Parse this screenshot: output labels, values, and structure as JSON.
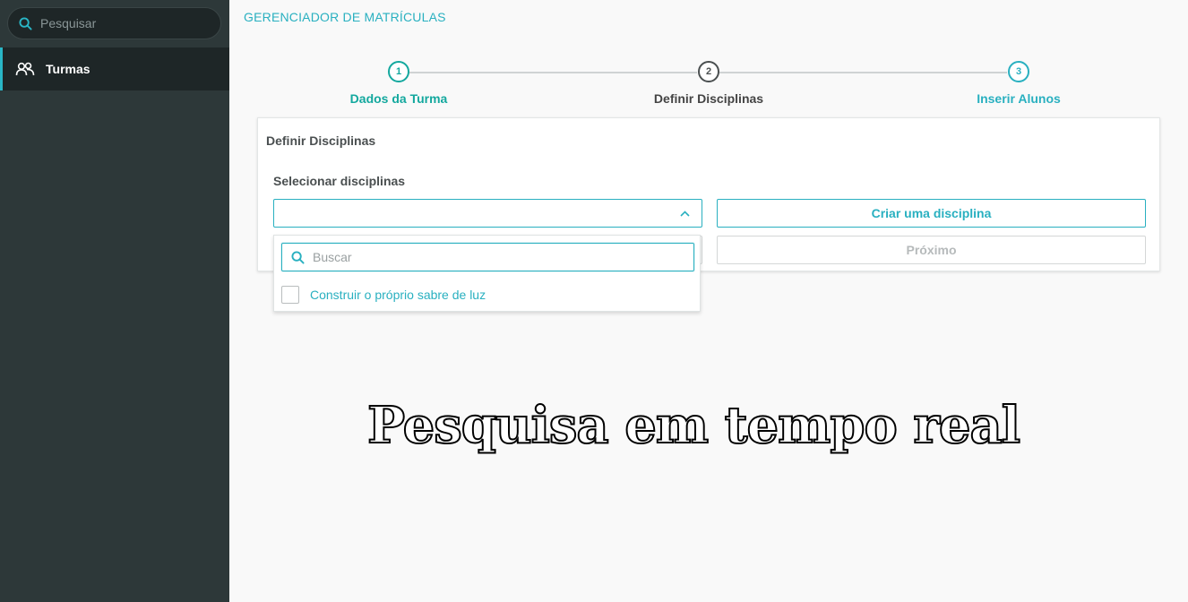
{
  "sidebar": {
    "search": {
      "placeholder": "Pesquisar",
      "icon": "search-icon"
    },
    "items": [
      {
        "label": "Turmas",
        "icon": "users-icon",
        "active": true
      }
    ]
  },
  "page": {
    "title": "GERENCIADOR DE MATRÍCULAS"
  },
  "stepper": {
    "steps": [
      {
        "number": "1",
        "label": "Dados da Turma",
        "color": "#13a89e"
      },
      {
        "number": "2",
        "label": "Definir Disciplinas",
        "color": "#4a4f50"
      },
      {
        "number": "3",
        "label": "Inserir Alunos",
        "color": "#29b0c0"
      }
    ]
  },
  "card": {
    "title": "Definir Disciplinas",
    "field_label": "Selecionar disciplinas",
    "create_button": "Criar uma disciplina",
    "next_button": "Próximo"
  },
  "dropdown": {
    "search_placeholder": "Buscar",
    "options": [
      {
        "label": "Construir o próprio sabre de luz",
        "checked": false
      }
    ]
  },
  "caption": "Pesquisa em tempo real",
  "colors": {
    "accent": "#29b0c0",
    "success": "#13a89e",
    "sidebar": "#2d3839"
  }
}
